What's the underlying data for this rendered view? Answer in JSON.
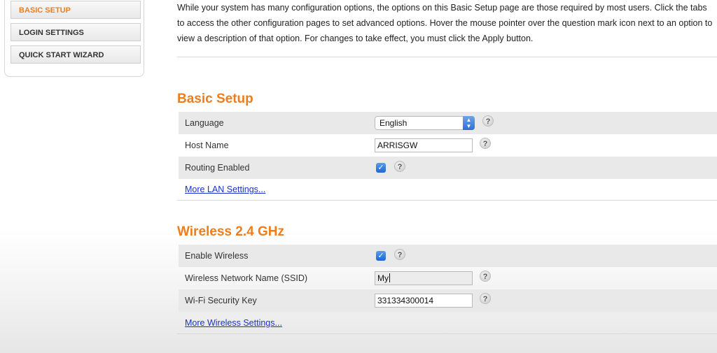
{
  "sidebar": {
    "items": [
      {
        "label": "BASIC SETUP",
        "active": true
      },
      {
        "label": "LOGIN SETTINGS",
        "active": false
      },
      {
        "label": "QUICK START WIZARD",
        "active": false
      }
    ]
  },
  "intro": {
    "text": "While your system has many configuration options, the options on this Basic Setup page are those required by most users. Click the tabs to access the other configuration pages to set advanced options. Hover the mouse pointer over the question mark icon next to an option to view a description of that option. For changes to take effect, you must click the Apply button."
  },
  "basic_setup": {
    "title": "Basic Setup",
    "language_label": "Language",
    "language_value": "English",
    "host_name_label": "Host Name",
    "host_name_value": "ARRISGW",
    "routing_label": "Routing Enabled",
    "routing_checked": true,
    "more_link": "More LAN Settings..."
  },
  "wireless": {
    "title": "Wireless 2.4 GHz",
    "enable_label": "Enable Wireless",
    "enable_checked": true,
    "ssid_label": "Wireless Network Name (SSID)",
    "ssid_value": "My",
    "key_label": "Wi-Fi Security Key",
    "key_value": "331334300014",
    "more_link": "More Wireless Settings..."
  },
  "help_glyph": "?",
  "check_glyph": "✓",
  "colors": {
    "accent": "#f07d1a",
    "link": "#1a32c8",
    "row_shade": "#e9e9e9",
    "checkbox": "#2f6fd6"
  }
}
